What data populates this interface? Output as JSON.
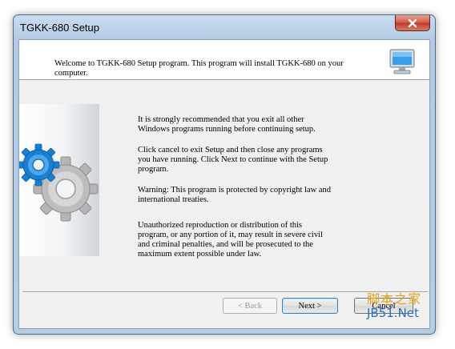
{
  "window": {
    "title": "TGKK-680 Setup"
  },
  "header": {
    "text": "Welcome to TGKK-680 Setup program. This program will install TGKK-680 on your computer."
  },
  "body": {
    "paragraphs": [
      "It is strongly recommended that you exit all other\nWindows programs running before continuing setup.",
      "Click cancel to exit Setup and then close any programs\nyou have running. Click Next to continue with the Setup\nprogram.",
      "Warning: This program is protected by copyright law and\ninternational treaties.",
      "Unauthorized reproduction or distribution of this\nprogram, or any portion of it, may result in severe civil\nand criminal penalties, and will be prosecuted to the\nmaximum extent possible under law."
    ]
  },
  "buttons": {
    "back_label": "< Back",
    "next_label": "Next >",
    "cancel_label": "Cancel"
  },
  "watermark": {
    "line1": "脚本之家",
    "line2": "JB51.Net"
  },
  "icons": {
    "close": "close-icon",
    "monitor": "monitor-icon",
    "gears": "gears-icon"
  },
  "colors": {
    "titlebar": "#b3cbe4",
    "close_button": "#c0392b",
    "gear_blue": "#1a7fd1",
    "gear_gray": "#b8b8b8",
    "watermark_orange": "#e8a01a",
    "watermark_blue": "#2a6fbf"
  }
}
